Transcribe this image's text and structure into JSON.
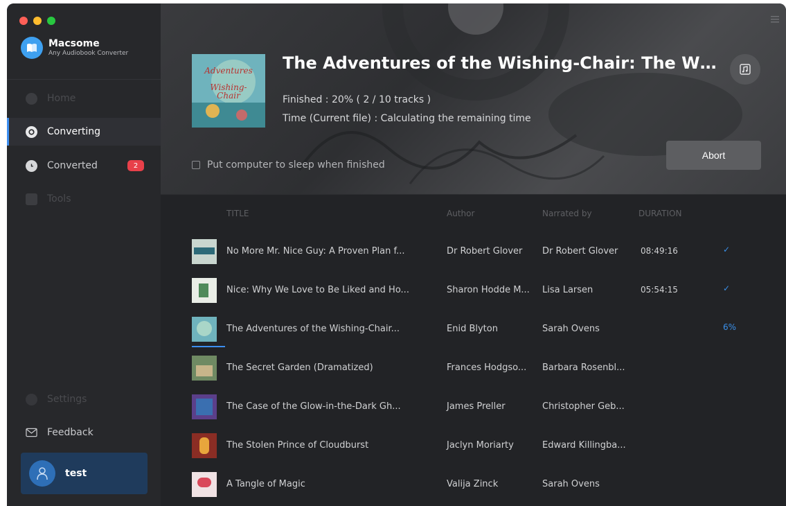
{
  "app": {
    "name": "Macsome",
    "subtitle": "Any Audiobook Converter"
  },
  "sidebar": {
    "items": [
      {
        "label": "Home",
        "icon": "home-icon"
      },
      {
        "label": "Converting",
        "icon": "converting-icon"
      },
      {
        "label": "Converted",
        "icon": "clock-icon",
        "badge": "2"
      },
      {
        "label": "Tools",
        "icon": "toolbox-icon"
      },
      {
        "label": "Settings",
        "icon": "gear-icon"
      },
      {
        "label": "Feedback",
        "icon": "mail-icon"
      }
    ],
    "user": {
      "name": "test"
    }
  },
  "current": {
    "title": "The Adventures of the Wishing-Chair: The Wishing-Chair Series",
    "finished": "Finished : 20% ( 2 / 10 tracks )",
    "time": "Time (Current file) : Calculating the remaining time",
    "sleep_label": "Put computer to sleep when finished",
    "abort_label": "Abort",
    "progress_fraction": 0.2
  },
  "table": {
    "headers": {
      "title": "TITLE",
      "author": "Author",
      "narrated": "Narrated by",
      "duration": "DURATION"
    },
    "rows": [
      {
        "title": "No More Mr. Nice Guy: A Proven Plan f...",
        "author": "Dr Robert Glover",
        "narrated": "Dr Robert Glover",
        "duration": "08:49:16",
        "status": "✓"
      },
      {
        "title": "Nice: Why We Love to Be Liked and Ho...",
        "author": "Sharon Hodde M...",
        "narrated": "Lisa Larsen",
        "duration": "05:54:15",
        "status": "✓"
      },
      {
        "title": "The Adventures of the Wishing-Chair...",
        "author": "Enid Blyton",
        "narrated": "Sarah Ovens",
        "duration": "",
        "status": "6%"
      },
      {
        "title": "The Secret Garden (Dramatized)",
        "author": "Frances Hodgso...",
        "narrated": "Barbara Rosenbl...",
        "duration": "",
        "status": ""
      },
      {
        "title": "The Case of the Glow-in-the-Dark Gh...",
        "author": "James Preller",
        "narrated": "Christopher Geb...",
        "duration": "",
        "status": ""
      },
      {
        "title": "The Stolen Prince of Cloudburst",
        "author": "Jaclyn Moriarty",
        "narrated": "Edward Killingba...",
        "duration": "",
        "status": ""
      },
      {
        "title": "A Tangle of Magic",
        "author": "Valija Zinck",
        "narrated": "Sarah Ovens",
        "duration": "",
        "status": ""
      }
    ]
  },
  "colors": {
    "accent": "#3d8ef0",
    "badge": "#e8404a",
    "sidebar_bg": "#27282b",
    "main_bg": "#222326"
  }
}
